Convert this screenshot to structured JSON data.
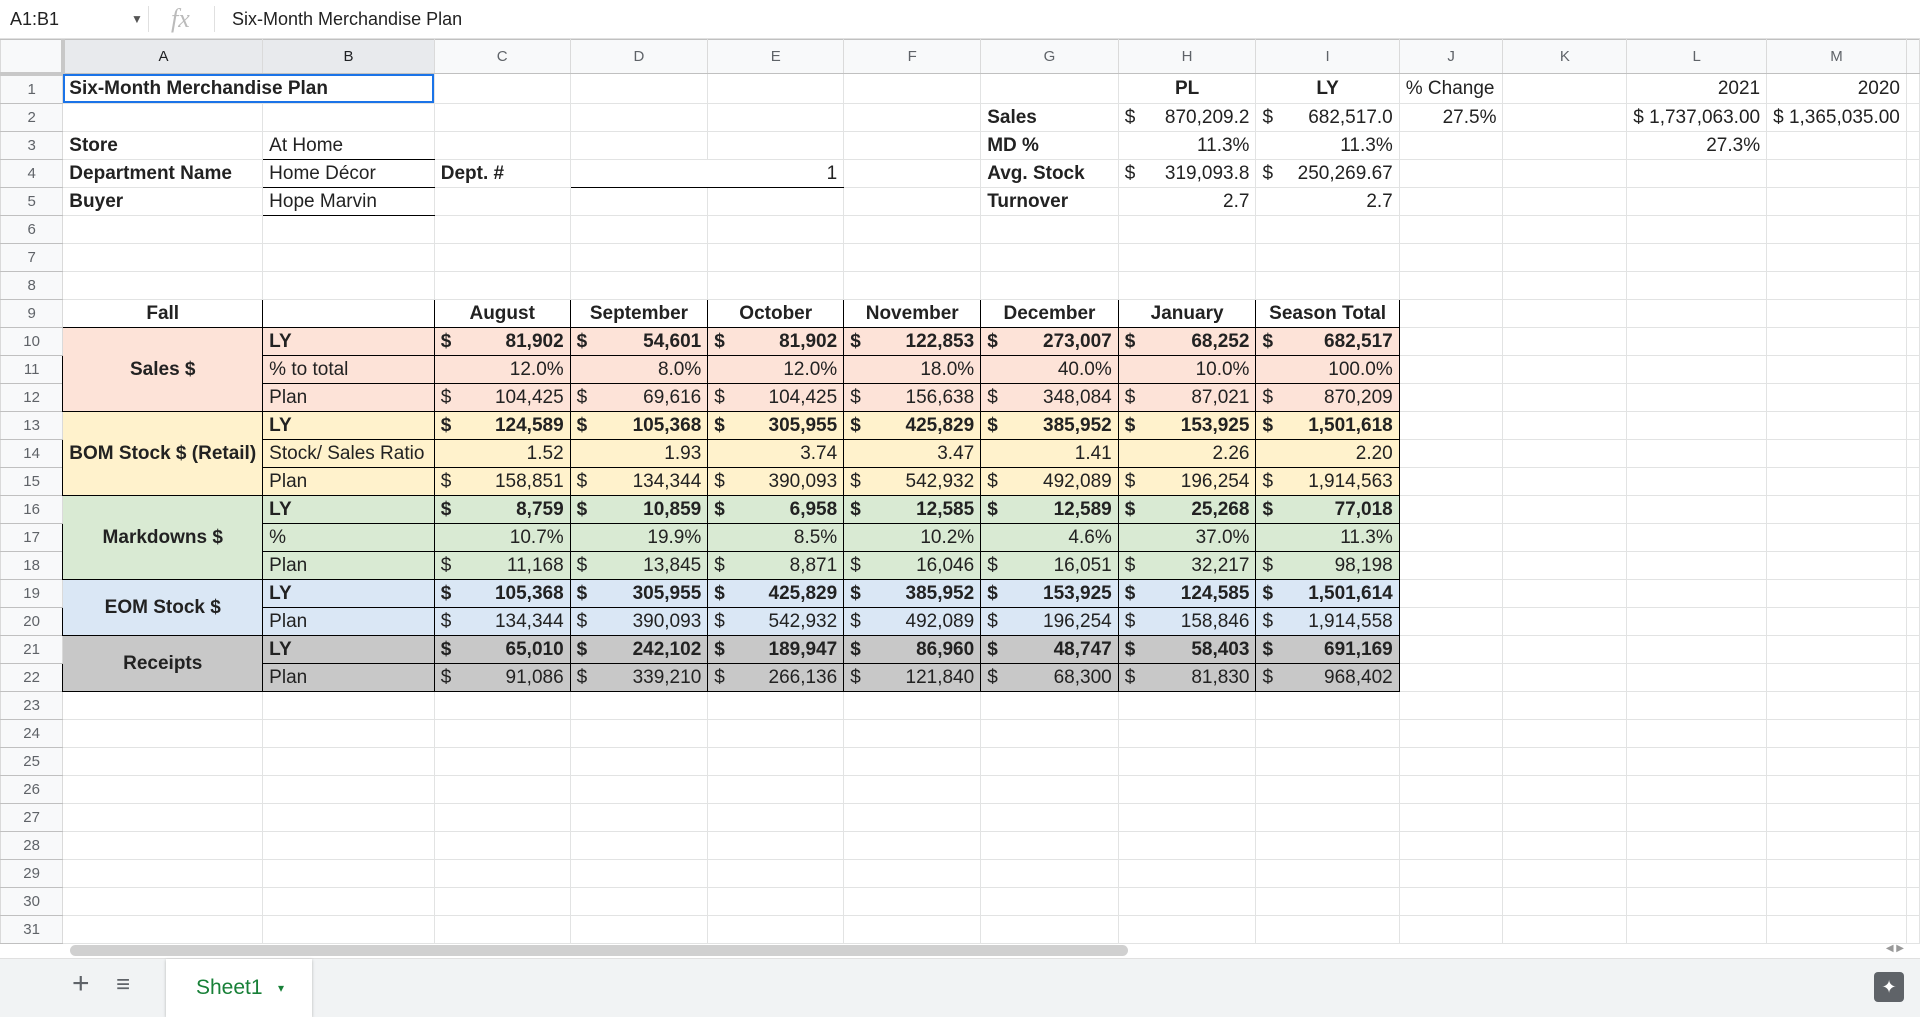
{
  "formula_bar": {
    "cell_ref": "A1:B1",
    "fx": "fx",
    "formula": "Six-Month Merchandise Plan"
  },
  "columns": [
    "A",
    "B",
    "C",
    "D",
    "E",
    "F",
    "G",
    "H",
    "I",
    "J",
    "K",
    "L",
    "M"
  ],
  "rows": [
    "1",
    "2",
    "3",
    "4",
    "5",
    "6",
    "7",
    "8",
    "9",
    "10",
    "11",
    "12",
    "13",
    "14",
    "15",
    "16",
    "17",
    "18",
    "19",
    "20",
    "21",
    "22",
    "23",
    "24",
    "25",
    "26",
    "27",
    "28",
    "29",
    "30",
    "31"
  ],
  "header": {
    "title": "Six-Month Merchandise Plan",
    "store_label": "Store",
    "store_value": "At Home",
    "dept_label": "Department Name",
    "dept_value": "Home Décor",
    "deptno_label": "Dept. #",
    "deptno_value": "1",
    "buyer_label": "Buyer",
    "buyer_value": "Hope Marvin"
  },
  "summary": {
    "pl_label": "PL",
    "ly_label": "LY",
    "change_label": "% Change",
    "y2021": "2021",
    "y2020": "2020",
    "rows": [
      {
        "label": "Sales",
        "pl": "870,209.2",
        "ly": "682,517.0",
        "change": "27.5%",
        "v2021": "$ 1,737,063.00",
        "v2020": "$ 1,365,035.00",
        "pl_dollar": true,
        "ly_dollar": true
      },
      {
        "label": "MD %",
        "pl": "11.3%",
        "ly": "11.3%",
        "extra": "27.3%"
      },
      {
        "label": "Avg. Stock",
        "pl": "319,093.8",
        "ly": "250,269.67",
        "pl_dollar": true,
        "ly_dollar": true
      },
      {
        "label": "Turnover",
        "pl": "2.7",
        "ly": "2.7"
      }
    ]
  },
  "plan": {
    "season": "Fall",
    "months": [
      "August",
      "September",
      "October",
      "November",
      "December",
      "January",
      "Season Total"
    ],
    "dollar": "$",
    "groups": [
      {
        "name": "Sales $",
        "color": "bg-o",
        "rows": [
          {
            "label": "LY",
            "bold": true,
            "dollar": true,
            "values": [
              "81,902",
              "54,601",
              "81,902",
              "122,853",
              "273,007",
              "68,252",
              "682,517"
            ]
          },
          {
            "label": "% to total",
            "bold": false,
            "dollar": false,
            "values": [
              "12.0%",
              "8.0%",
              "12.0%",
              "18.0%",
              "40.0%",
              "10.0%",
              "100.0%"
            ]
          },
          {
            "label": "Plan",
            "bold": false,
            "dollar": true,
            "values": [
              "104,425",
              "69,616",
              "104,425",
              "156,638",
              "348,084",
              "87,021",
              "870,209"
            ]
          }
        ]
      },
      {
        "name": "BOM Stock $ (Retail)",
        "color": "bg-y",
        "rows": [
          {
            "label": "LY",
            "bold": true,
            "dollar": true,
            "values": [
              "124,589",
              "105,368",
              "305,955",
              "425,829",
              "385,952",
              "153,925",
              "1,501,618"
            ]
          },
          {
            "label": "Stock/ Sales Ratio",
            "bold": false,
            "dollar": false,
            "values": [
              "1.52",
              "1.93",
              "3.74",
              "3.47",
              "1.41",
              "2.26",
              "2.20"
            ]
          },
          {
            "label": "Plan",
            "bold": false,
            "dollar": true,
            "values": [
              "158,851",
              "134,344",
              "390,093",
              "542,932",
              "492,089",
              "196,254",
              "1,914,563"
            ]
          }
        ]
      },
      {
        "name": "Markdowns $",
        "color": "bg-g",
        "rows": [
          {
            "label": "LY",
            "bold": true,
            "dollar": true,
            "values": [
              "8,759",
              "10,859",
              "6,958",
              "12,585",
              "12,589",
              "25,268",
              "77,018"
            ]
          },
          {
            "label": "%",
            "bold": false,
            "dollar": false,
            "values": [
              "10.7%",
              "19.9%",
              "8.5%",
              "10.2%",
              "4.6%",
              "37.0%",
              "11.3%"
            ]
          },
          {
            "label": "Plan",
            "bold": false,
            "dollar": true,
            "values": [
              "11,168",
              "13,845",
              "8,871",
              "16,046",
              "16,051",
              "32,217",
              "98,198"
            ]
          }
        ]
      },
      {
        "name": "EOM Stock $",
        "color": "bg-b",
        "rows": [
          {
            "label": "LY",
            "bold": true,
            "dollar": true,
            "values": [
              "105,368",
              "305,955",
              "425,829",
              "385,952",
              "153,925",
              "124,585",
              "1,501,614"
            ]
          },
          {
            "label": "Plan",
            "bold": false,
            "dollar": true,
            "values": [
              "134,344",
              "390,093",
              "542,932",
              "492,089",
              "196,254",
              "158,846",
              "1,914,558"
            ]
          }
        ]
      },
      {
        "name": "Receipts",
        "color": "bg-gr",
        "rows": [
          {
            "label": "LY",
            "bold": true,
            "dollar": true,
            "values": [
              "65,010",
              "242,102",
              "189,947",
              "86,960",
              "48,747",
              "58,403",
              "691,169"
            ]
          },
          {
            "label": "Plan",
            "bold": false,
            "dollar": true,
            "values": [
              "91,086",
              "339,210",
              "266,136",
              "121,840",
              "68,300",
              "81,830",
              "968,402"
            ]
          }
        ]
      }
    ]
  },
  "sheet_tabs": {
    "add": "+",
    "list": "≡",
    "active": "Sheet1",
    "arrow": "▾"
  },
  "explore": "✦"
}
